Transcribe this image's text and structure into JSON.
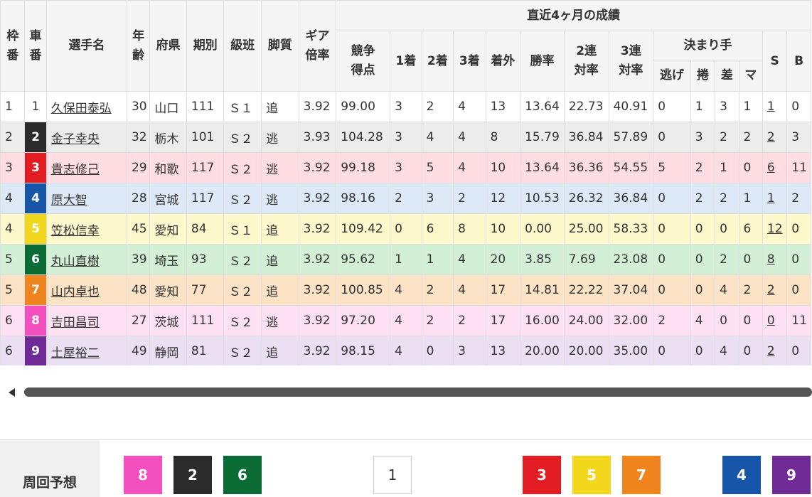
{
  "table": {
    "headers": {
      "waku_1": "枠",
      "waku_2": "番",
      "car_1": "車",
      "car_2": "番",
      "name": "選手名",
      "age_1": "年",
      "age_2": "齢",
      "pref": "府県",
      "term": "期別",
      "class": "級班",
      "style": "脚質",
      "gear_1": "ギア",
      "gear_2": "倍率",
      "recent": "直近4ヶ月の成績",
      "score_1": "競争",
      "score_2": "得点",
      "first": "1着",
      "second": "2着",
      "third": "3着",
      "out": "着外",
      "win_rate": "勝率",
      "rate2_1": "2連",
      "rate2_2": "対率",
      "rate3_1": "3連",
      "rate3_2": "対率",
      "kimarite": "決まり手",
      "nige": "逃げ",
      "makuri": "捲",
      "sashi": "差",
      "mark": "マ",
      "s": "S",
      "b": "B"
    },
    "rows": [
      {
        "waku": "1",
        "car": "1",
        "name": "久保田泰弘",
        "age": "30",
        "pref": "山口",
        "term": "111",
        "cls": "Ｓ１",
        "style": "追",
        "gear": "3.92",
        "score": "99.00",
        "first": "3",
        "second": "2",
        "third": "4",
        "out": "13",
        "win": "13.64",
        "r2": "22.73",
        "r3": "40.91",
        "nige": "0",
        "makuri": "1",
        "sashi": "3",
        "mark": "1",
        "s": "1",
        "b": "0"
      },
      {
        "waku": "2",
        "car": "2",
        "name": "金子幸央",
        "age": "32",
        "pref": "栃木",
        "term": "101",
        "cls": "Ｓ２",
        "style": "逃",
        "gear": "3.93",
        "score": "104.28",
        "first": "3",
        "second": "4",
        "third": "4",
        "out": "8",
        "win": "15.79",
        "r2": "36.84",
        "r3": "57.89",
        "nige": "0",
        "makuri": "3",
        "sashi": "2",
        "mark": "2",
        "s": "2",
        "b": "3"
      },
      {
        "waku": "3",
        "car": "3",
        "name": "貴志修己",
        "age": "29",
        "pref": "和歌",
        "term": "117",
        "cls": "Ｓ２",
        "style": "逃",
        "gear": "3.92",
        "score": "99.18",
        "first": "3",
        "second": "5",
        "third": "4",
        "out": "10",
        "win": "13.64",
        "r2": "36.36",
        "r3": "54.55",
        "nige": "5",
        "makuri": "2",
        "sashi": "1",
        "mark": "0",
        "s": "6",
        "b": "11"
      },
      {
        "waku": "4",
        "car": "4",
        "name": "原大智",
        "age": "28",
        "pref": "宮城",
        "term": "117",
        "cls": "Ｓ２",
        "style": "逃",
        "gear": "3.92",
        "score": "98.16",
        "first": "2",
        "second": "3",
        "third": "2",
        "out": "12",
        "win": "10.53",
        "r2": "26.32",
        "r3": "36.84",
        "nige": "0",
        "makuri": "2",
        "sashi": "2",
        "mark": "1",
        "s": "1",
        "b": "2"
      },
      {
        "waku": "4",
        "car": "5",
        "name": "笠松信幸",
        "age": "45",
        "pref": "愛知",
        "term": "84",
        "cls": "Ｓ１",
        "style": "追",
        "gear": "3.92",
        "score": "109.42",
        "first": "0",
        "second": "6",
        "third": "8",
        "out": "10",
        "win": "0.00",
        "r2": "25.00",
        "r3": "58.33",
        "nige": "0",
        "makuri": "0",
        "sashi": "0",
        "mark": "6",
        "s": "12",
        "b": "0"
      },
      {
        "waku": "5",
        "car": "6",
        "name": "丸山直樹",
        "age": "39",
        "pref": "埼玉",
        "term": "93",
        "cls": "Ｓ２",
        "style": "追",
        "gear": "3.92",
        "score": "95.62",
        "first": "1",
        "second": "1",
        "third": "4",
        "out": "20",
        "win": "3.85",
        "r2": "7.69",
        "r3": "23.08",
        "nige": "0",
        "makuri": "0",
        "sashi": "2",
        "mark": "0",
        "s": "8",
        "b": "0"
      },
      {
        "waku": "5",
        "car": "7",
        "name": "山内卓也",
        "age": "48",
        "pref": "愛知",
        "term": "77",
        "cls": "Ｓ２",
        "style": "追",
        "gear": "3.92",
        "score": "100.85",
        "first": "4",
        "second": "2",
        "third": "4",
        "out": "17",
        "win": "14.81",
        "r2": "22.22",
        "r3": "37.04",
        "nige": "0",
        "makuri": "0",
        "sashi": "4",
        "mark": "2",
        "s": "2",
        "b": "0"
      },
      {
        "waku": "6",
        "car": "8",
        "name": "吉田昌司",
        "age": "27",
        "pref": "茨城",
        "term": "111",
        "cls": "Ｓ２",
        "style": "逃",
        "gear": "3.92",
        "score": "97.20",
        "first": "4",
        "second": "2",
        "third": "2",
        "out": "17",
        "win": "16.00",
        "r2": "24.00",
        "r3": "32.00",
        "nige": "2",
        "makuri": "4",
        "sashi": "0",
        "mark": "0",
        "s": "0",
        "b": "11"
      },
      {
        "waku": "6",
        "car": "9",
        "name": "土屋裕二",
        "age": "49",
        "pref": "静岡",
        "term": "81",
        "cls": "Ｓ２",
        "style": "追",
        "gear": "3.92",
        "score": "98.15",
        "first": "4",
        "second": "0",
        "third": "3",
        "out": "13",
        "win": "20.00",
        "r2": "20.00",
        "r3": "35.00",
        "nige": "0",
        "makuri": "0",
        "sashi": "4",
        "mark": "0",
        "s": "2",
        "b": "0"
      }
    ]
  },
  "car_colors": {
    "1": {
      "bg": "#ffffff",
      "fg": "#333333",
      "row": "#ffffff"
    },
    "2": {
      "bg": "#2b2b2b",
      "fg": "#ffffff",
      "row": "#ececec"
    },
    "3": {
      "bg": "#e31b23",
      "fg": "#ffffff",
      "row": "#ffdde3"
    },
    "4": {
      "bg": "#1655a8",
      "fg": "#ffffff",
      "row": "#dde9f7"
    },
    "5": {
      "bg": "#f3d71c",
      "fg": "#ffffff",
      "row": "#fdf9cc"
    },
    "6": {
      "bg": "#0b6b35",
      "fg": "#ffffff",
      "row": "#d3f0d7"
    },
    "7": {
      "bg": "#f0841f",
      "fg": "#ffffff",
      "row": "#fde3c6"
    },
    "8": {
      "bg": "#f34fbf",
      "fg": "#ffffff",
      "row": "#fde1f3"
    },
    "9": {
      "bg": "#6f2a96",
      "fg": "#ffffff",
      "row": "#ebdff4"
    }
  },
  "forecast": {
    "label": "周回予想",
    "chips": [
      "8",
      "2",
      "6",
      "1",
      "3",
      "5",
      "7",
      "4",
      "9"
    ]
  },
  "scrollbar": {
    "left_arrow_icon": "triangle-left-icon"
  }
}
